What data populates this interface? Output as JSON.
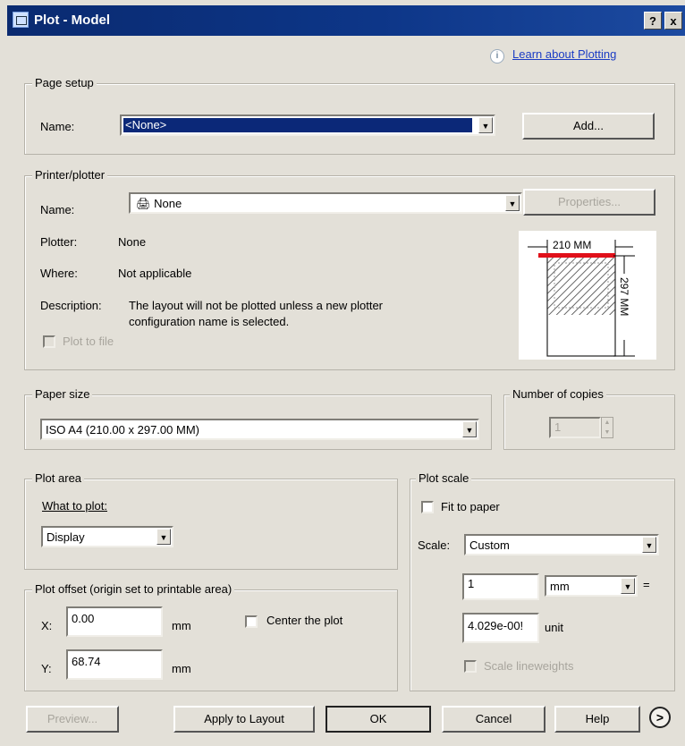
{
  "window": {
    "title": "Plot - Model",
    "help_btn": "?",
    "close_btn": "x"
  },
  "learn_link": {
    "icon": "i",
    "text": "Learn about Plotting"
  },
  "page_setup": {
    "legend": "Page setup",
    "name_label": "Name:",
    "name_value": "<None>",
    "add_button": "Add..."
  },
  "printer": {
    "legend": "Printer/plotter",
    "name_label": "Name:",
    "name_value": "None",
    "properties_button": "Properties...",
    "plotter_label": "Plotter:",
    "plotter_value": "None",
    "where_label": "Where:",
    "where_value": "Not applicable",
    "description_label": "Description:",
    "description_line1": "The layout will not be plotted unless a new plotter",
    "description_line2": "configuration name is selected.",
    "plot_to_file": "Plot to file",
    "preview": {
      "width_label": "210 MM",
      "height_label": "297 MM"
    }
  },
  "paper_size": {
    "legend": "Paper size",
    "value": "ISO A4 (210.00 x 297.00 MM)"
  },
  "copies": {
    "legend": "Number of copies",
    "value": "1"
  },
  "plot_area": {
    "legend": "Plot area",
    "what_label": "What to plot:",
    "what_value": "Display"
  },
  "plot_offset": {
    "legend": "Plot offset (origin set to printable area)",
    "x_label": "X:",
    "x_value": "0.00",
    "x_unit": "mm",
    "y_label": "Y:",
    "y_value": "68.74",
    "y_unit": "mm",
    "center_label": "Center the plot"
  },
  "plot_scale": {
    "legend": "Plot scale",
    "fit_label": "Fit to paper",
    "scale_label": "Scale:",
    "scale_value": "Custom",
    "num_value": "1",
    "unit_value": "mm",
    "equals": "=",
    "den_value": "4.029e-00!",
    "den_unit": "unit",
    "scale_lw_label": "Scale lineweights"
  },
  "buttons": {
    "preview": "Preview...",
    "apply": "Apply to Layout",
    "ok": "OK",
    "cancel": "Cancel",
    "help": "Help",
    "more": ">"
  }
}
